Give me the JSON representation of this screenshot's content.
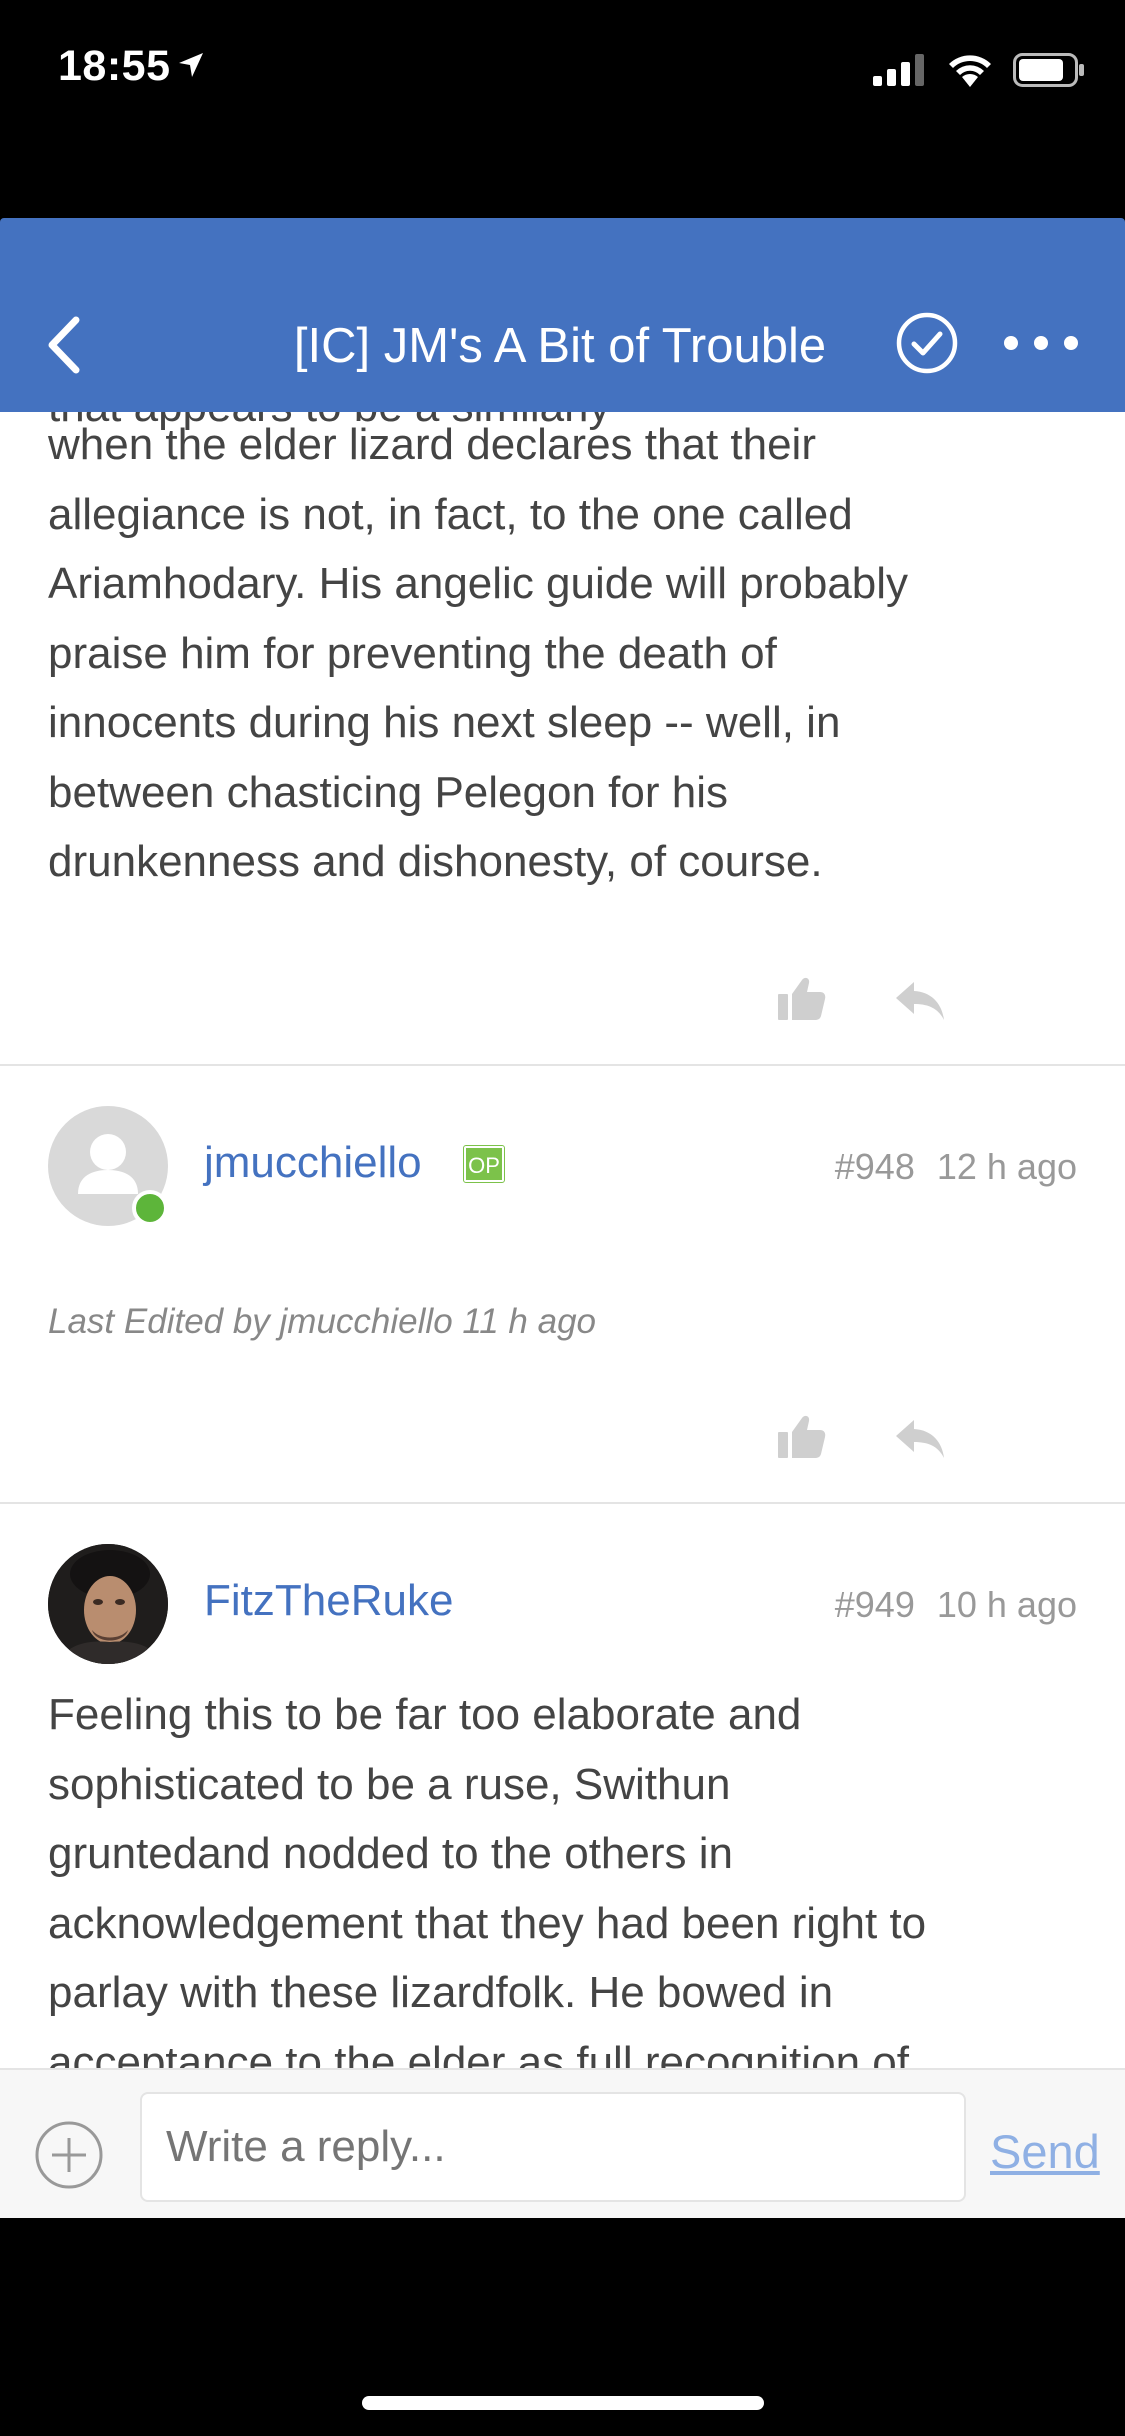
{
  "status_bar": {
    "time": "18:55"
  },
  "nav": {
    "title": "[IC] JM's A Bit of Trouble"
  },
  "posts": [
    {
      "cut_line": "that appears to be a similarly",
      "lines": [
        "when the elder lizard declares that their",
        "allegiance is not, in fact, to the one called",
        "Ariamhodary. His angelic guide will probably",
        "praise him for preventing the death of",
        "innocents during his next sleep -- well, in",
        "between chasticing Pelegon for his",
        "drunkenness and dishonesty, of course."
      ]
    },
    {
      "username": "jmucchiello",
      "badge": "OP",
      "number": "#948",
      "time": "12 h ago",
      "edited": "Last Edited by jmucchiello 11 h ago"
    },
    {
      "username": "FitzTheRuke",
      "number": "#949",
      "time": "10 h ago",
      "lines": [
        "Feeling this to be far too elaborate and",
        "sophisticated to be a ruse, Swithun",
        "gruntedand nodded to the others in",
        "acknowledgement that they had been right to",
        "parlay with these lizardfolk. He bowed in",
        "acceptance to the elder as full recognition of"
      ]
    }
  ],
  "reply": {
    "placeholder": "Write a reply...",
    "send": "Send"
  },
  "colors": {
    "accent": "#4472c0",
    "online": "#5db53a",
    "op_badge": "#7cc24a"
  }
}
